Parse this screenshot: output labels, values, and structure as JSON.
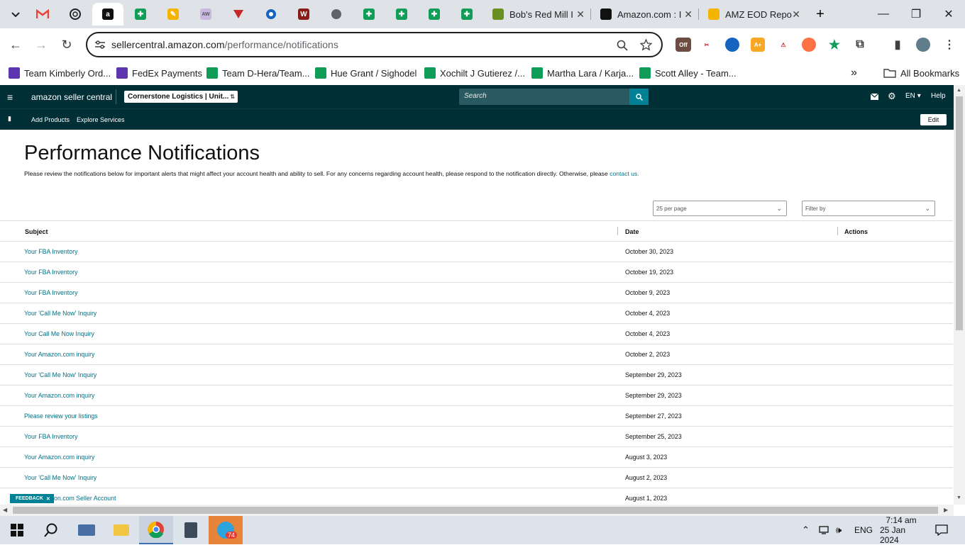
{
  "browser": {
    "tabs": [
      {
        "title": "",
        "icon": "gmail-icon"
      },
      {
        "title": "",
        "icon": "openai-icon"
      },
      {
        "title": "",
        "icon": "amazon-icon",
        "active": true
      },
      {
        "title": "",
        "icon": "sheets-icon"
      },
      {
        "title": "",
        "icon": "pencil-app-icon"
      },
      {
        "title": "",
        "icon": "site-icon"
      },
      {
        "title": "",
        "icon": "triangle-logo-icon"
      },
      {
        "title": "",
        "icon": "blue-gear-icon"
      },
      {
        "title": "",
        "icon": "vw-icon"
      },
      {
        "title": "",
        "icon": "globe-icon"
      },
      {
        "title": "",
        "icon": "sheets-icon"
      },
      {
        "title": "",
        "icon": "sheets-icon"
      },
      {
        "title": "",
        "icon": "sheets-icon"
      },
      {
        "title": "",
        "icon": "sheets-icon"
      },
      {
        "title": "Bob's Red Mill I",
        "icon": "bobs-icon"
      },
      {
        "title": "Amazon.com : I",
        "icon": "amazon-icon"
      },
      {
        "title": "AMZ EOD Repo",
        "icon": "pencil-app-icon"
      }
    ],
    "url_host": "sellercentral.amazon.com",
    "url_path": "/performance/notifications",
    "bookmarks": [
      "Team Kimberly Ord...",
      "FedEx Payments",
      "Team D-Hera/Team...",
      "Hue Grant / Sighodel",
      "Xochilt J Gutierez /...",
      "Martha Lara / Karja...",
      "Scott Alley - Team..."
    ],
    "all_bookmarks": "All Bookmarks",
    "extension_badge": "Off"
  },
  "seller_central": {
    "logo": "amazon seller central",
    "marketplace": "Cornerstone Logistics | Unit...",
    "search_placeholder": "Search",
    "lang": "EN",
    "help": "Help",
    "nav": [
      "Add Products",
      "Explore Services"
    ],
    "edit": "Edit"
  },
  "page": {
    "title": "Performance Notifications",
    "intro": "Please review the notifications below for important alerts that might affect your account health and ability to sell. For any concerns regarding account health, please respond to the notification directly. Otherwise, please",
    "contact": "contact us.",
    "per_page": "25 per page",
    "filter": "Filter by",
    "columns": {
      "subject": "Subject",
      "date": "Date",
      "actions": "Actions"
    },
    "rows": [
      {
        "subject": "Your FBA Inventory",
        "date": "October 30, 2023"
      },
      {
        "subject": "Your FBA Inventory",
        "date": "October 19, 2023"
      },
      {
        "subject": "Your FBA Inventory",
        "date": "October 9, 2023"
      },
      {
        "subject": "Your 'Call Me Now' Inquiry",
        "date": "October 4, 2023"
      },
      {
        "subject": "Your Call Me Now Inquiry",
        "date": "October 4, 2023"
      },
      {
        "subject": "Your Amazon.com inquiry",
        "date": "October 2, 2023"
      },
      {
        "subject": "Your 'Call Me Now' Inquiry",
        "date": "September 29, 2023"
      },
      {
        "subject": "Your Amazon.com inquiry",
        "date": "September 29, 2023"
      },
      {
        "subject": "Please review your listings",
        "date": "September 27, 2023"
      },
      {
        "subject": "Your FBA Inventory",
        "date": "September 25, 2023"
      },
      {
        "subject": "Your Amazon.com inquiry",
        "date": "August 3, 2023"
      },
      {
        "subject": "Your 'Call Me Now' Inquiry",
        "date": "August 2, 2023"
      },
      {
        "subject": "on.com Seller Account",
        "date": "August 1, 2023"
      }
    ],
    "feedback": "FEEDBACK"
  },
  "taskbar": {
    "lang": "ENG",
    "time": "7:14 am",
    "date": "25 Jan 2024",
    "telegram_badge": "74"
  }
}
